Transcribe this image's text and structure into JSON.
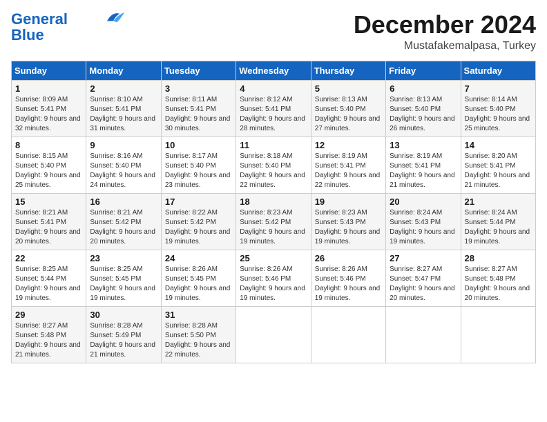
{
  "logo": {
    "line1": "General",
    "line2": "Blue"
  },
  "header": {
    "month": "December 2024",
    "location": "Mustafakemalpasa, Turkey"
  },
  "weekdays": [
    "Sunday",
    "Monday",
    "Tuesday",
    "Wednesday",
    "Thursday",
    "Friday",
    "Saturday"
  ],
  "weeks": [
    [
      {
        "day": "1",
        "sunrise": "Sunrise: 8:09 AM",
        "sunset": "Sunset: 5:41 PM",
        "daylight": "Daylight: 9 hours and 32 minutes."
      },
      {
        "day": "2",
        "sunrise": "Sunrise: 8:10 AM",
        "sunset": "Sunset: 5:41 PM",
        "daylight": "Daylight: 9 hours and 31 minutes."
      },
      {
        "day": "3",
        "sunrise": "Sunrise: 8:11 AM",
        "sunset": "Sunset: 5:41 PM",
        "daylight": "Daylight: 9 hours and 30 minutes."
      },
      {
        "day": "4",
        "sunrise": "Sunrise: 8:12 AM",
        "sunset": "Sunset: 5:41 PM",
        "daylight": "Daylight: 9 hours and 28 minutes."
      },
      {
        "day": "5",
        "sunrise": "Sunrise: 8:13 AM",
        "sunset": "Sunset: 5:40 PM",
        "daylight": "Daylight: 9 hours and 27 minutes."
      },
      {
        "day": "6",
        "sunrise": "Sunrise: 8:13 AM",
        "sunset": "Sunset: 5:40 PM",
        "daylight": "Daylight: 9 hours and 26 minutes."
      },
      {
        "day": "7",
        "sunrise": "Sunrise: 8:14 AM",
        "sunset": "Sunset: 5:40 PM",
        "daylight": "Daylight: 9 hours and 25 minutes."
      }
    ],
    [
      {
        "day": "8",
        "sunrise": "Sunrise: 8:15 AM",
        "sunset": "Sunset: 5:40 PM",
        "daylight": "Daylight: 9 hours and 25 minutes."
      },
      {
        "day": "9",
        "sunrise": "Sunrise: 8:16 AM",
        "sunset": "Sunset: 5:40 PM",
        "daylight": "Daylight: 9 hours and 24 minutes."
      },
      {
        "day": "10",
        "sunrise": "Sunrise: 8:17 AM",
        "sunset": "Sunset: 5:40 PM",
        "daylight": "Daylight: 9 hours and 23 minutes."
      },
      {
        "day": "11",
        "sunrise": "Sunrise: 8:18 AM",
        "sunset": "Sunset: 5:40 PM",
        "daylight": "Daylight: 9 hours and 22 minutes."
      },
      {
        "day": "12",
        "sunrise": "Sunrise: 8:19 AM",
        "sunset": "Sunset: 5:41 PM",
        "daylight": "Daylight: 9 hours and 22 minutes."
      },
      {
        "day": "13",
        "sunrise": "Sunrise: 8:19 AM",
        "sunset": "Sunset: 5:41 PM",
        "daylight": "Daylight: 9 hours and 21 minutes."
      },
      {
        "day": "14",
        "sunrise": "Sunrise: 8:20 AM",
        "sunset": "Sunset: 5:41 PM",
        "daylight": "Daylight: 9 hours and 21 minutes."
      }
    ],
    [
      {
        "day": "15",
        "sunrise": "Sunrise: 8:21 AM",
        "sunset": "Sunset: 5:41 PM",
        "daylight": "Daylight: 9 hours and 20 minutes."
      },
      {
        "day": "16",
        "sunrise": "Sunrise: 8:21 AM",
        "sunset": "Sunset: 5:42 PM",
        "daylight": "Daylight: 9 hours and 20 minutes."
      },
      {
        "day": "17",
        "sunrise": "Sunrise: 8:22 AM",
        "sunset": "Sunset: 5:42 PM",
        "daylight": "Daylight: 9 hours and 19 minutes."
      },
      {
        "day": "18",
        "sunrise": "Sunrise: 8:23 AM",
        "sunset": "Sunset: 5:42 PM",
        "daylight": "Daylight: 9 hours and 19 minutes."
      },
      {
        "day": "19",
        "sunrise": "Sunrise: 8:23 AM",
        "sunset": "Sunset: 5:43 PM",
        "daylight": "Daylight: 9 hours and 19 minutes."
      },
      {
        "day": "20",
        "sunrise": "Sunrise: 8:24 AM",
        "sunset": "Sunset: 5:43 PM",
        "daylight": "Daylight: 9 hours and 19 minutes."
      },
      {
        "day": "21",
        "sunrise": "Sunrise: 8:24 AM",
        "sunset": "Sunset: 5:44 PM",
        "daylight": "Daylight: 9 hours and 19 minutes."
      }
    ],
    [
      {
        "day": "22",
        "sunrise": "Sunrise: 8:25 AM",
        "sunset": "Sunset: 5:44 PM",
        "daylight": "Daylight: 9 hours and 19 minutes."
      },
      {
        "day": "23",
        "sunrise": "Sunrise: 8:25 AM",
        "sunset": "Sunset: 5:45 PM",
        "daylight": "Daylight: 9 hours and 19 minutes."
      },
      {
        "day": "24",
        "sunrise": "Sunrise: 8:26 AM",
        "sunset": "Sunset: 5:45 PM",
        "daylight": "Daylight: 9 hours and 19 minutes."
      },
      {
        "day": "25",
        "sunrise": "Sunrise: 8:26 AM",
        "sunset": "Sunset: 5:46 PM",
        "daylight": "Daylight: 9 hours and 19 minutes."
      },
      {
        "day": "26",
        "sunrise": "Sunrise: 8:26 AM",
        "sunset": "Sunset: 5:46 PM",
        "daylight": "Daylight: 9 hours and 19 minutes."
      },
      {
        "day": "27",
        "sunrise": "Sunrise: 8:27 AM",
        "sunset": "Sunset: 5:47 PM",
        "daylight": "Daylight: 9 hours and 20 minutes."
      },
      {
        "day": "28",
        "sunrise": "Sunrise: 8:27 AM",
        "sunset": "Sunset: 5:48 PM",
        "daylight": "Daylight: 9 hours and 20 minutes."
      }
    ],
    [
      {
        "day": "29",
        "sunrise": "Sunrise: 8:27 AM",
        "sunset": "Sunset: 5:48 PM",
        "daylight": "Daylight: 9 hours and 21 minutes."
      },
      {
        "day": "30",
        "sunrise": "Sunrise: 8:28 AM",
        "sunset": "Sunset: 5:49 PM",
        "daylight": "Daylight: 9 hours and 21 minutes."
      },
      {
        "day": "31",
        "sunrise": "Sunrise: 8:28 AM",
        "sunset": "Sunset: 5:50 PM",
        "daylight": "Daylight: 9 hours and 22 minutes."
      },
      null,
      null,
      null,
      null
    ]
  ]
}
